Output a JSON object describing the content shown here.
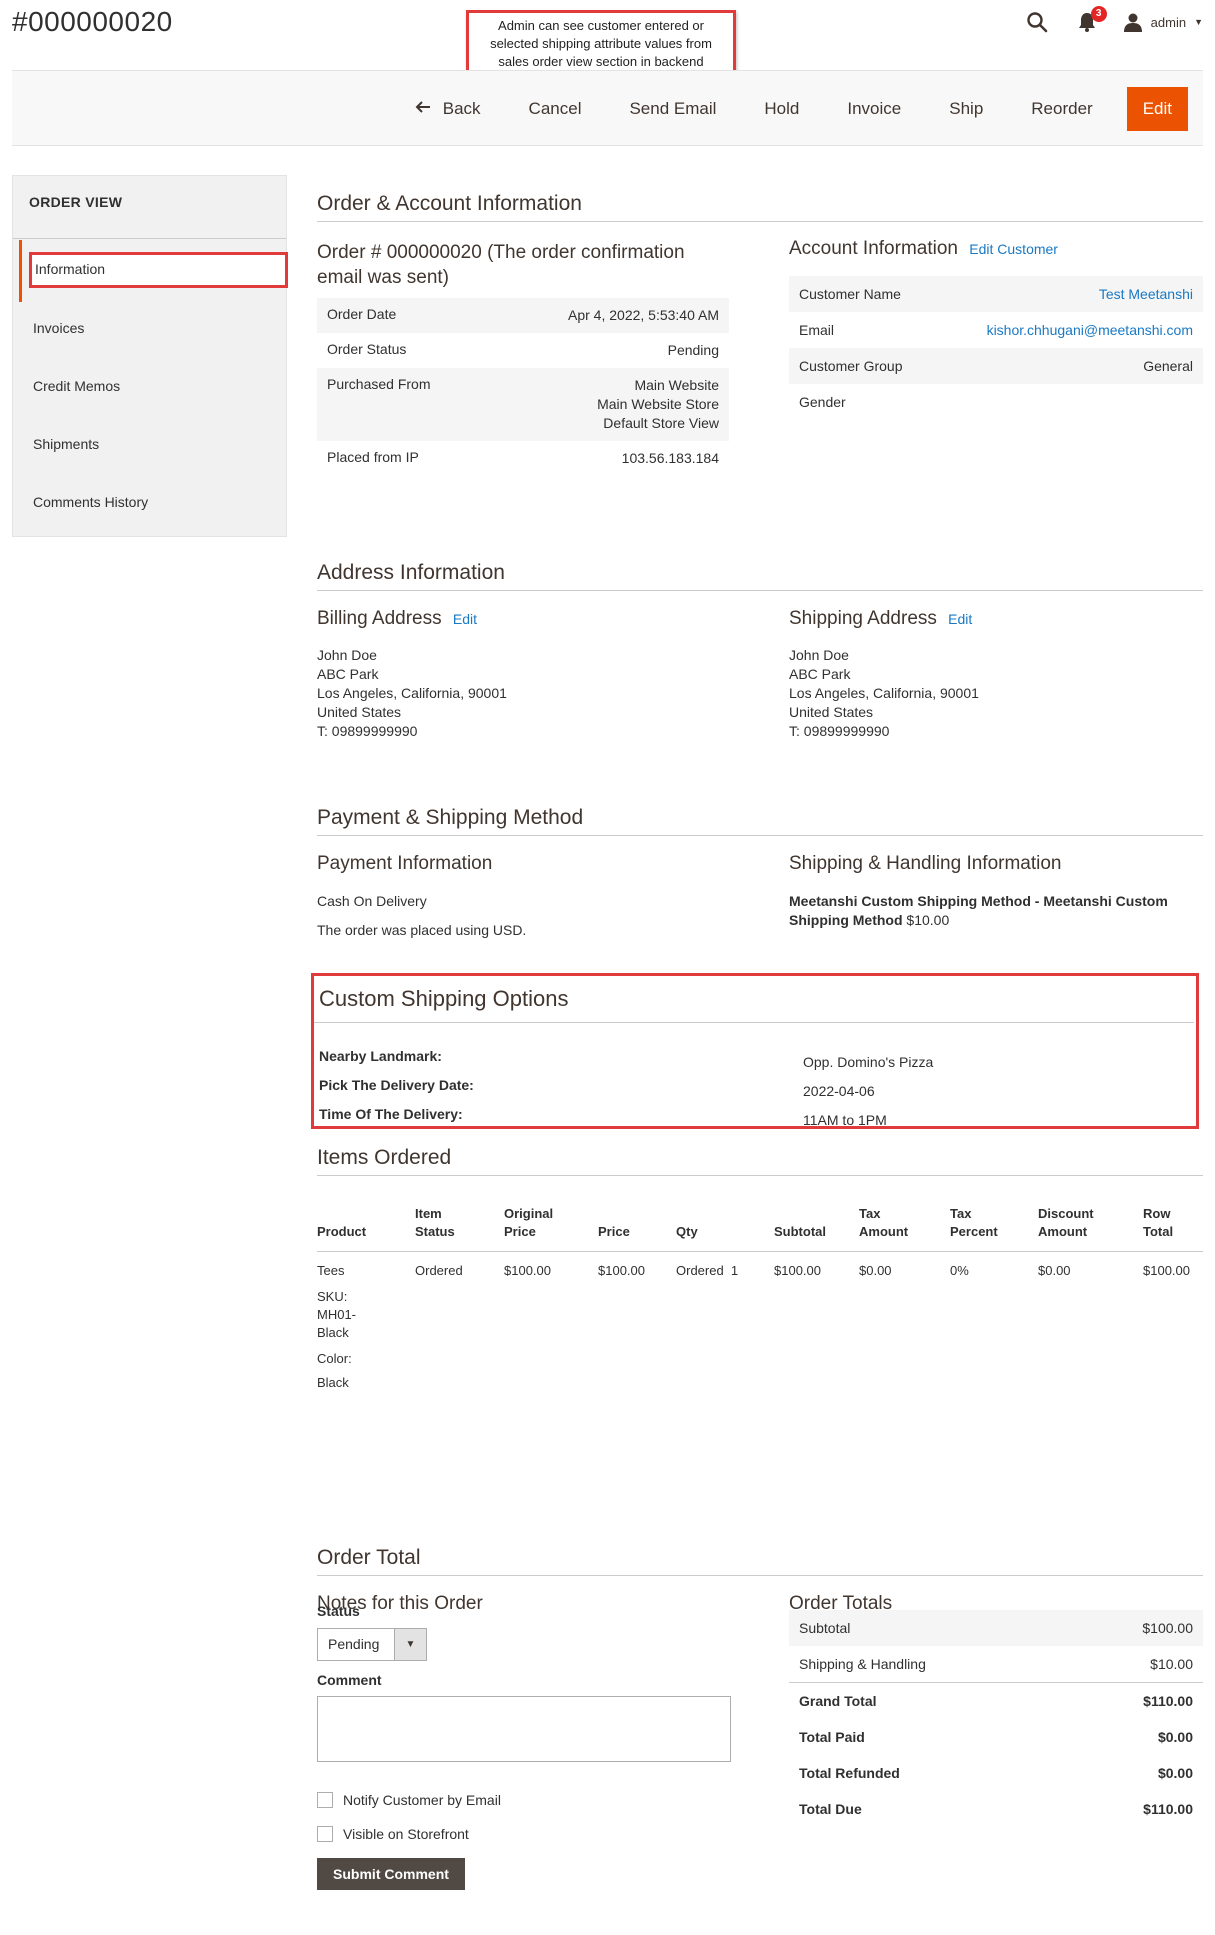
{
  "header": {
    "title": "#000000020",
    "annotation": "Admin can see customer entered or selected shipping attribute values from sales order view section in backend",
    "notification_count": "3",
    "user": "admin"
  },
  "toolbar": {
    "back": "Back",
    "cancel": "Cancel",
    "send_email": "Send Email",
    "hold": "Hold",
    "invoice": "Invoice",
    "ship": "Ship",
    "reorder": "Reorder",
    "edit": "Edit"
  },
  "sidebar": {
    "title": "ORDER VIEW",
    "items": [
      {
        "label": "Information"
      },
      {
        "label": "Invoices"
      },
      {
        "label": "Credit Memos"
      },
      {
        "label": "Shipments"
      },
      {
        "label": "Comments History"
      }
    ]
  },
  "order_account": {
    "section_title": "Order & Account Information",
    "order_heading_line1": "Order # 000000020 (The order confirmation",
    "order_heading_line2": "email was sent)",
    "order_rows": [
      {
        "label": "Order Date",
        "value": "Apr 4, 2022, 5:53:40 AM"
      },
      {
        "label": "Order Status",
        "value": "Pending"
      },
      {
        "label": "Purchased From",
        "value_lines": [
          "Main Website",
          "Main Website Store",
          "Default Store View"
        ]
      },
      {
        "label": "Placed from IP",
        "value": "103.56.183.184"
      }
    ],
    "account_heading": "Account Information",
    "edit_customer": "Edit Customer",
    "account_rows": [
      {
        "label": "Customer Name",
        "value": "Test Meetanshi"
      },
      {
        "label": "Email",
        "value": "kishor.chhugani@meetanshi.com"
      },
      {
        "label": "Customer Group",
        "value": "General"
      },
      {
        "label": "Gender",
        "value": ""
      }
    ]
  },
  "address": {
    "section_title": "Address Information",
    "billing_heading": "Billing Address",
    "shipping_heading": "Shipping Address",
    "edit_label": "Edit",
    "billing_lines": [
      "John Doe",
      "ABC Park",
      "Los Angeles, California, 90001",
      "United States",
      "T: 09899999990"
    ],
    "shipping_lines": [
      "John Doe",
      "ABC Park",
      "Los Angeles, California, 90001",
      "United States",
      "T: 09899999990"
    ]
  },
  "payment_shipping": {
    "section_title": "Payment & Shipping Method",
    "payment_heading": "Payment Information",
    "payment_method": "Cash On Delivery",
    "currency_note": "The order was placed using USD.",
    "shipping_heading": "Shipping & Handling Information",
    "shipping_method_line1": "Meetanshi Custom Shipping Method - Meetanshi Custom",
    "shipping_method_line2": "Shipping Method",
    "shipping_price": "$10.00"
  },
  "custom_shipping": {
    "title": "Custom Shipping Options",
    "rows": [
      {
        "label": "Nearby Landmark:",
        "value": "Opp. Domino's Pizza"
      },
      {
        "label": "Pick The Delivery Date:",
        "value": "2022-04-06"
      },
      {
        "label": "Time Of The Delivery:",
        "value": "11AM to 1PM"
      }
    ]
  },
  "items": {
    "section_title": "Items Ordered",
    "headers": [
      [
        "Product"
      ],
      [
        "Item",
        "Status"
      ],
      [
        "Original",
        "Price"
      ],
      [
        "Price"
      ],
      [
        "Qty"
      ],
      [
        "Subtotal"
      ],
      [
        "Tax",
        "Amount"
      ],
      [
        "Tax",
        "Percent"
      ],
      [
        "Discount",
        "Amount"
      ],
      [
        "Row",
        "Total"
      ]
    ],
    "row": {
      "product": "Tees",
      "sku_label": "SKU:",
      "sku_line1": "MH01-",
      "sku_line2": "Black",
      "color_label": "Color:",
      "color_value": "Black",
      "status": "Ordered",
      "original_price": "$100.00",
      "price": "$100.00",
      "qty": "Ordered  1",
      "subtotal": "$100.00",
      "tax_amount": "$0.00",
      "tax_percent": "0%",
      "discount": "$0.00",
      "row_total": "$100.00"
    }
  },
  "order_total": {
    "section_title": "Order Total",
    "notes_heading": "Notes for this Order",
    "status_label": "Status",
    "status_value": "Pending",
    "comment_label": "Comment",
    "notify_label": "Notify Customer by Email",
    "visible_label": "Visible on Storefront",
    "submit_label": "Submit Comment",
    "totals_heading": "Order Totals",
    "totals": [
      {
        "label": "Subtotal",
        "value": "$100.00"
      },
      {
        "label": "Shipping & Handling",
        "value": "$10.00"
      },
      {
        "label": "Grand Total",
        "value": "$110.00"
      },
      {
        "label": "Total Paid",
        "value": "$0.00"
      },
      {
        "label": "Total Refunded",
        "value": "$0.00"
      },
      {
        "label": "Total Due",
        "value": "$110.00"
      }
    ]
  }
}
